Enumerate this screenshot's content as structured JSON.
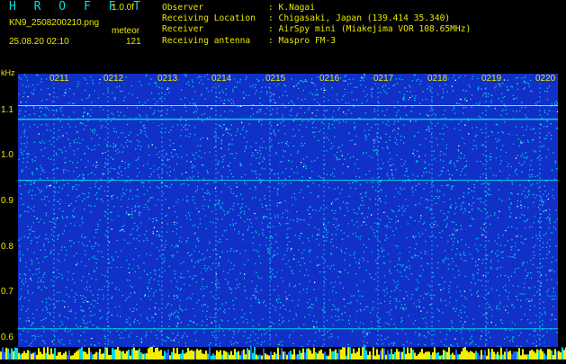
{
  "header": {
    "app_title": "H R O F F T",
    "version": "1.0.0f",
    "filename": "KN9_2508200210.png",
    "mode": "meteor",
    "datetime": "25.08.20 02:10",
    "count": "121",
    "info": [
      {
        "key": "Observer",
        "value": ": K.Nagai"
      },
      {
        "key": "Receiving Location",
        "value": ": Chigasaki, Japan (139.414 35.340)"
      },
      {
        "key": "Receiver",
        "value": ": AirSpy mini (Miakejima VOR 108.65MHz)"
      },
      {
        "key": "Receiving antenna",
        "value": ": Maspro FM-3"
      }
    ]
  },
  "chart_data": {
    "type": "heatmap",
    "y_unit": "kHz",
    "y_ticks": [
      "1.1",
      "1.0",
      "0.9",
      "0.8",
      "0.7",
      "0.6"
    ],
    "y_range": [
      0.58,
      1.18
    ],
    "time_ticks": [
      "0211",
      "0212",
      "0213",
      "0214",
      "0215",
      "0216",
      "0217",
      "0218",
      "0219",
      "0220"
    ],
    "carrier_lines_khz": [
      1.11,
      1.08,
      0.946,
      0.62
    ],
    "colors": {
      "background": "#1030c8",
      "signal": "#00e0e0",
      "strong": "#e8e800",
      "text": "#e8e800"
    }
  }
}
